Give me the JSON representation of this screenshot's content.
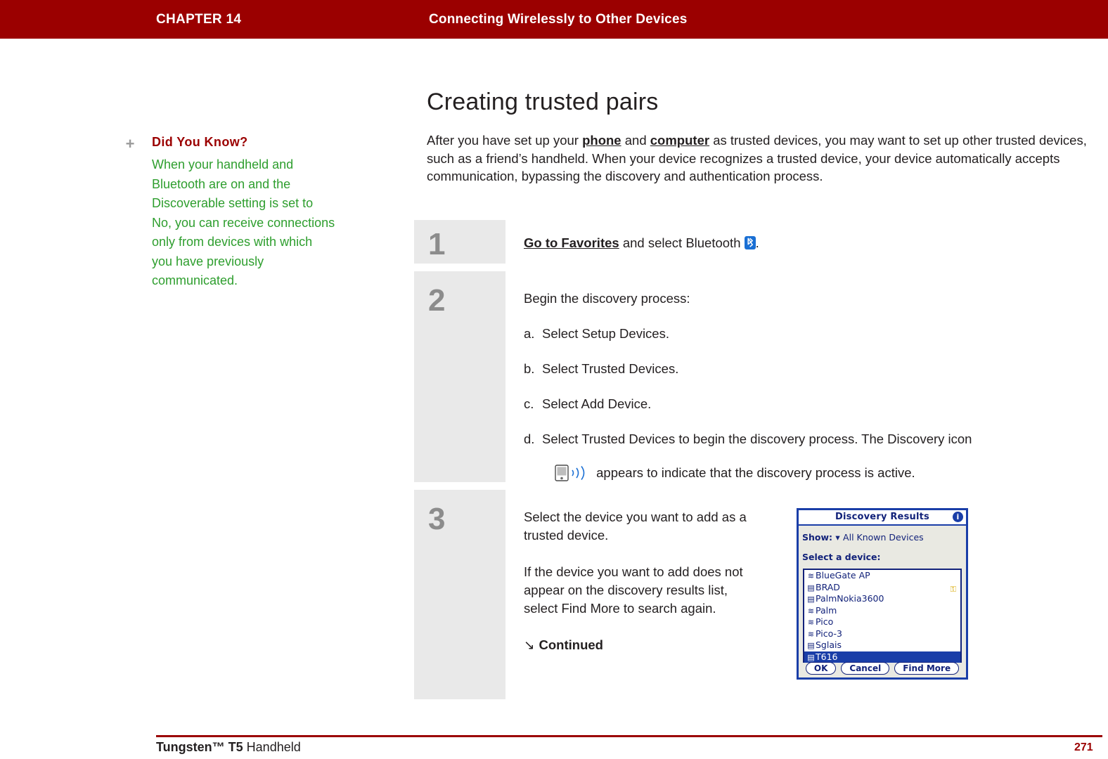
{
  "header": {
    "chapter": "CHAPTER 14",
    "title": "Connecting Wirelessly to Other Devices"
  },
  "sidebar": {
    "note_icon": "plus-icon",
    "note_title": "Did You Know?",
    "note_body": "When your handheld and Bluetooth are on and the Discoverable setting is set to No, you can receive connections only from devices with which you have previously communicated."
  },
  "main": {
    "page_title": "Creating trusted pairs",
    "intro_1": "After you have set up your ",
    "intro_link_1": "phone",
    "intro_2": " and ",
    "intro_link_2": "computer",
    "intro_3": " as trusted devices, you may want to set up other trusted devices, such as a friend’s handheld. When your device recognizes a trusted device, your device automatically accepts communication, bypassing the discovery and authentication process."
  },
  "steps": [
    {
      "num": "1",
      "link": "Go to Favorites",
      "text": " and select Bluetooth ",
      "tail": "."
    },
    {
      "num": "2",
      "lead": "Begin the discovery process:",
      "items": [
        {
          "label": "a.",
          "text": "Select Setup Devices."
        },
        {
          "label": "b.",
          "text": "Select Trusted Devices."
        },
        {
          "label": "c.",
          "text": "Select Add Device."
        },
        {
          "label": "d.",
          "text": "Select Trusted Devices to begin the discovery process. The Discovery icon"
        }
      ],
      "item_d_cont": " appears to indicate that the discovery process is active."
    },
    {
      "num": "3",
      "para_1": "Select the device you want to add as a trusted device.",
      "para_2": "If the device you want to add does not appear on the discovery results list, select Find More to search again.",
      "continued_arrow": "↘",
      "continued": "Continued"
    }
  ],
  "palm_screen": {
    "title": "Discovery Results",
    "info_icon": "i",
    "show_label": "Show:",
    "show_value": "All Known Devices",
    "select_label": "Select a device:",
    "devices": [
      {
        "icon": "wifi",
        "name": "BlueGate AP",
        "paired": false
      },
      {
        "icon": "device",
        "name": "BRAD",
        "paired": true
      },
      {
        "icon": "device",
        "name": "PalmNokia3600",
        "paired": false
      },
      {
        "icon": "wifi",
        "name": "Palm",
        "paired": false
      },
      {
        "icon": "wifi",
        "name": "Pico",
        "paired": false
      },
      {
        "icon": "wifi",
        "name": "Pico-3",
        "paired": false
      },
      {
        "icon": "device",
        "name": "Sglais",
        "paired": false
      },
      {
        "icon": "device",
        "name": "T616",
        "paired": false
      }
    ],
    "selected_index": 7,
    "buttons": [
      "OK",
      "Cancel",
      "Find More"
    ]
  },
  "footer": {
    "product_bold": "Tungsten™ T5",
    "product_rest": " Handheld",
    "page_number": "271"
  },
  "colors": {
    "header_bg": "#9b0000",
    "note_green": "#2e9e2e",
    "note_red": "#9b0000",
    "step_num_gray": "#8c8c8c",
    "palm_blue": "#1a3ea8"
  }
}
